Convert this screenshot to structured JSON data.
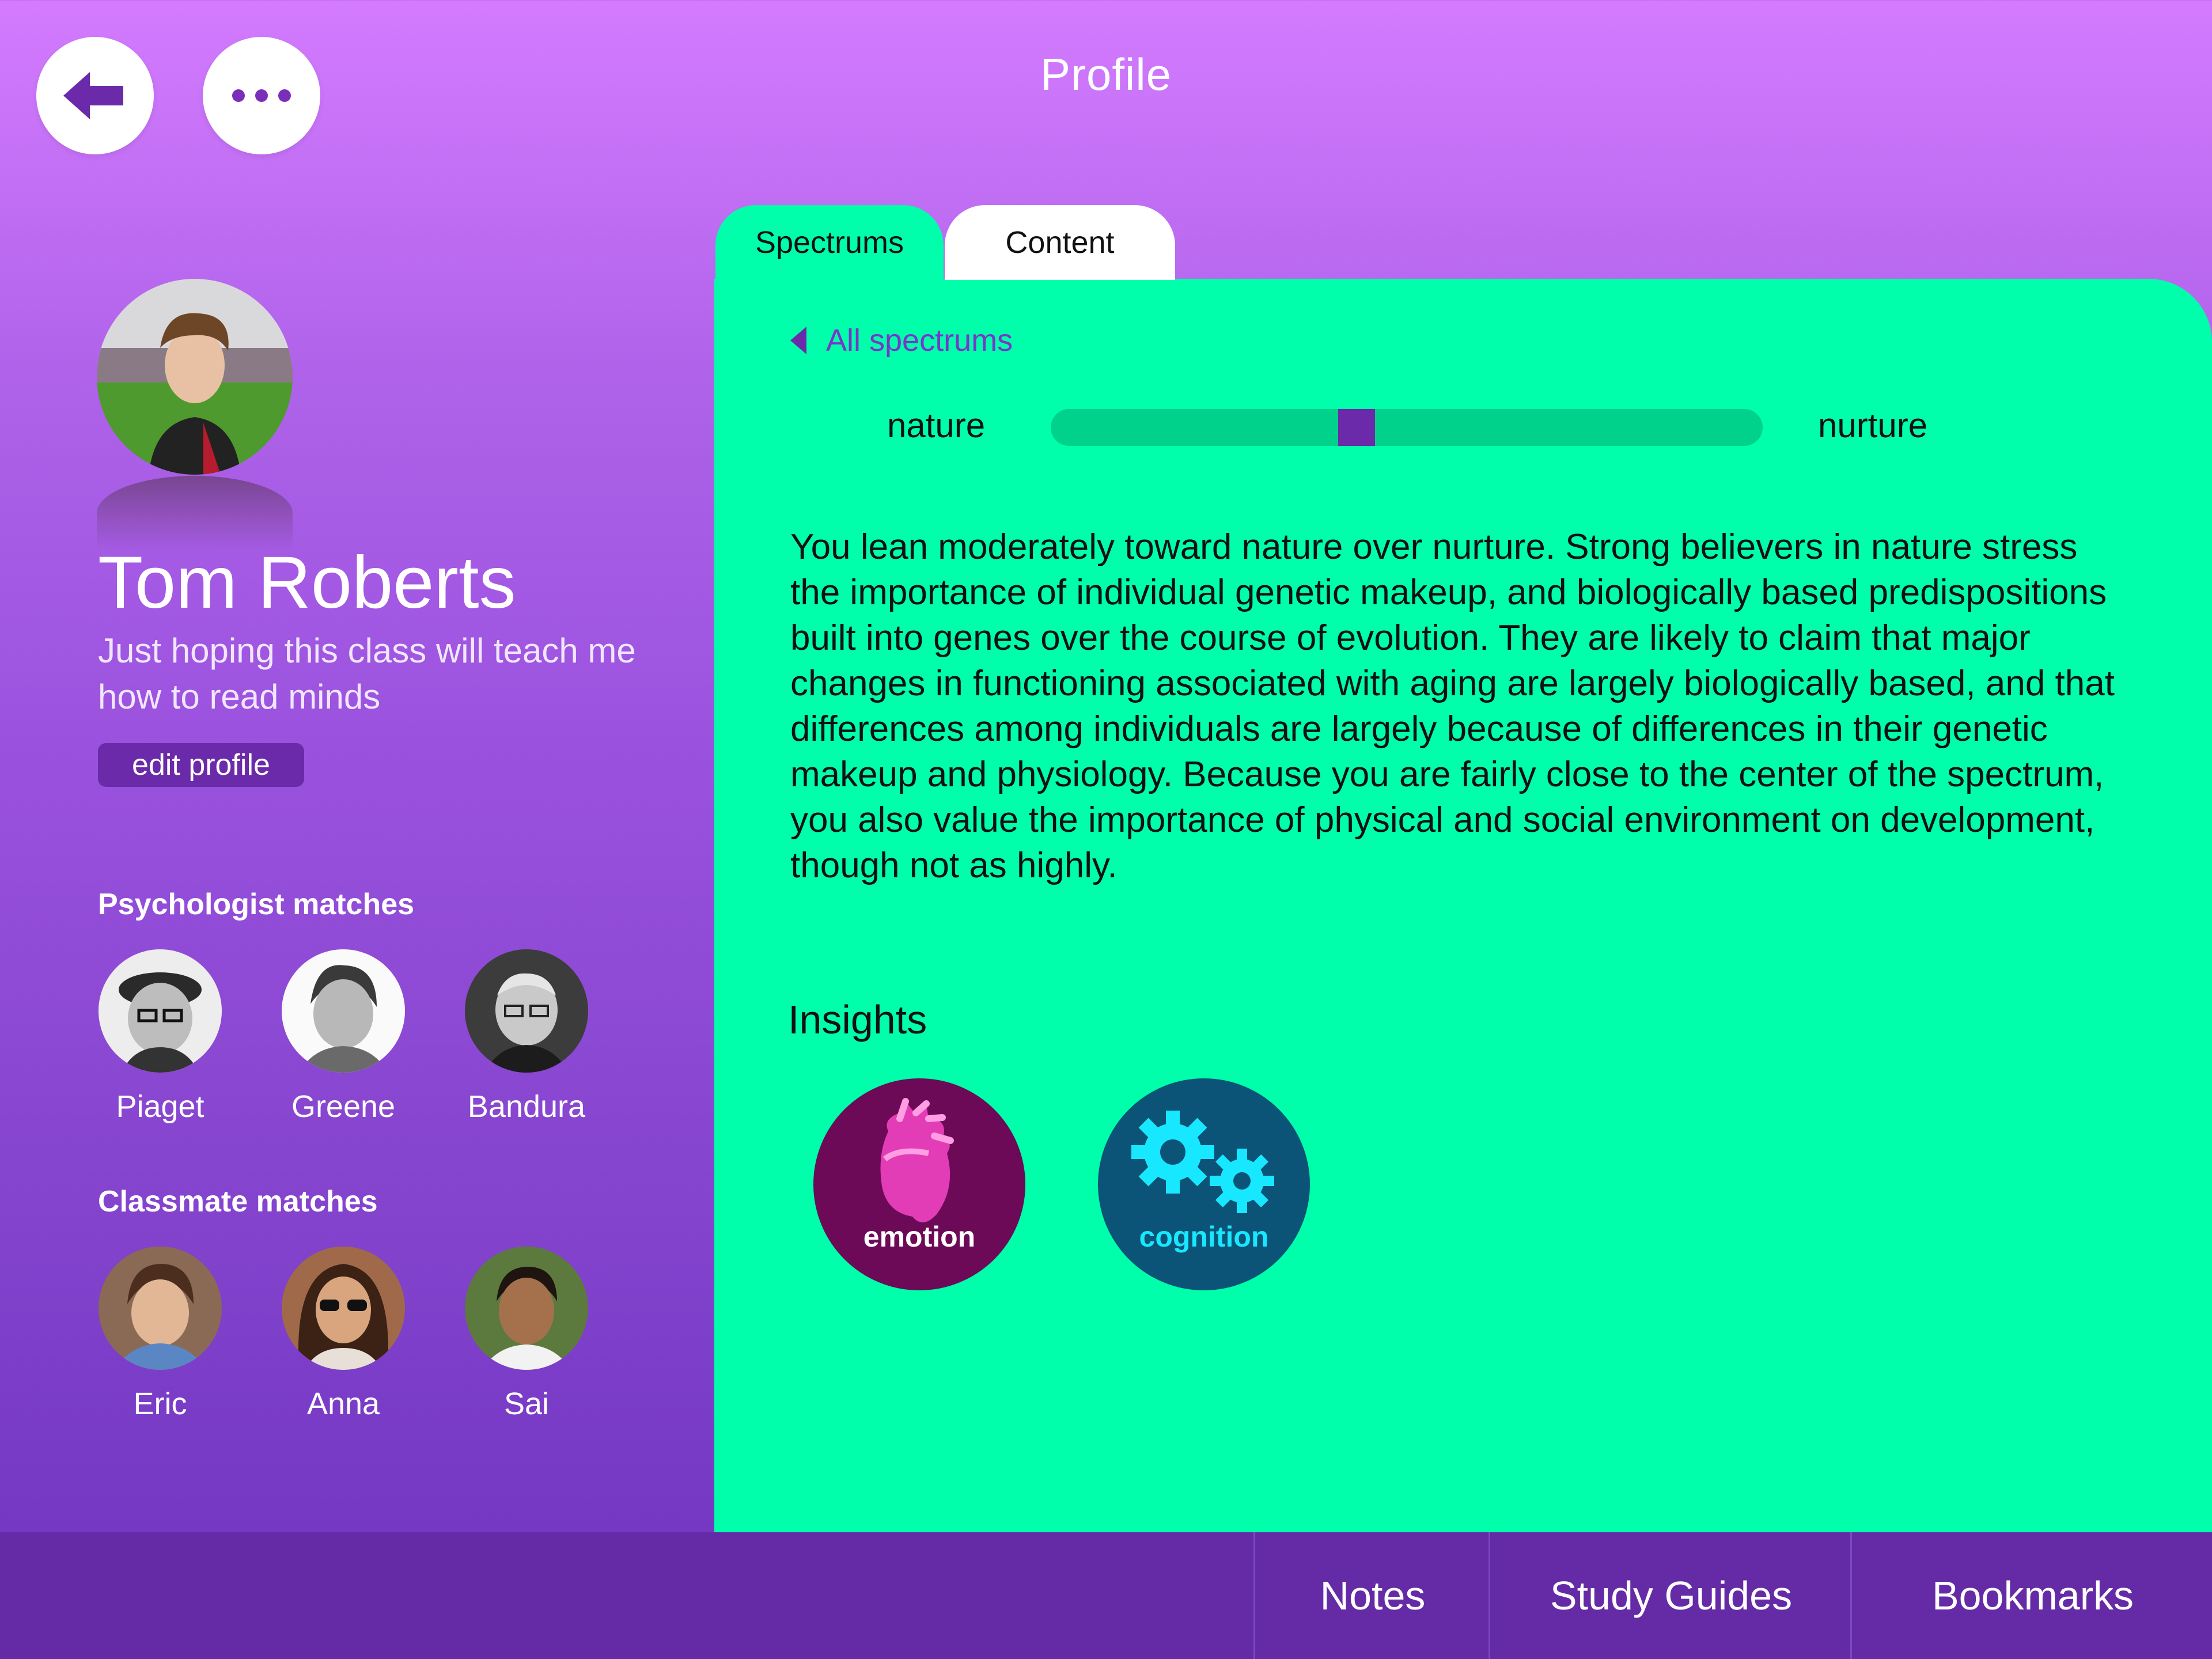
{
  "header": {
    "title": "Profile",
    "back_icon": "arrow-left-icon",
    "more_icon": "ellipsis-icon"
  },
  "profile": {
    "name": "Tom Roberts",
    "bio": "Just hoping this class will teach me how to read minds",
    "edit_label": "edit profile"
  },
  "psychologist_matches": {
    "label": "Psychologist matches",
    "items": [
      {
        "name": "Piaget",
        "color": "#cfcfcf"
      },
      {
        "name": "Greene",
        "color": "#e6e6e6"
      },
      {
        "name": "Bandura",
        "color": "#555555"
      }
    ]
  },
  "classmate_matches": {
    "label": "Classmate matches",
    "items": [
      {
        "name": "Eric",
        "color": "#8a6a55"
      },
      {
        "name": "Anna",
        "color": "#a06a4a"
      },
      {
        "name": "Sai",
        "color": "#5c7a3e"
      }
    ]
  },
  "tabs": [
    {
      "label": "Spectrums",
      "active": true
    },
    {
      "label": "Content",
      "active": false
    }
  ],
  "spectrum": {
    "back_link": "All spectrums",
    "left_label": "nature",
    "right_label": "nurture",
    "position": 0.43,
    "description": "You lean moderately toward nature over nurture. Strong believers in nature stress the importance of individual genetic makeup, and biologically based predispositions built into genes over the course of evolution. They are likely to claim that major changes in functioning associated with aging are largely biologically based, and that differences among individuals are largely because of differences in their genetic makeup and physiology. Because you are fairly close to the center of the spectrum, you also value the importance of physical and social environment on development, though not as highly."
  },
  "insights": {
    "title": "Insights",
    "items": [
      {
        "label": "emotion",
        "icon": "heart-icon"
      },
      {
        "label": "cognition",
        "icon": "gears-icon"
      }
    ]
  },
  "bottom_nav": {
    "notes": "Notes",
    "study_guides": "Study Guides",
    "bookmarks": "Bookmarks"
  },
  "colors": {
    "accent_purple": "#6a2aa9",
    "panel_green": "#00ffaa",
    "track_green": "#00d18b",
    "emotion_bg": "#6c0a57",
    "cognition_bg": "#0b5377"
  }
}
